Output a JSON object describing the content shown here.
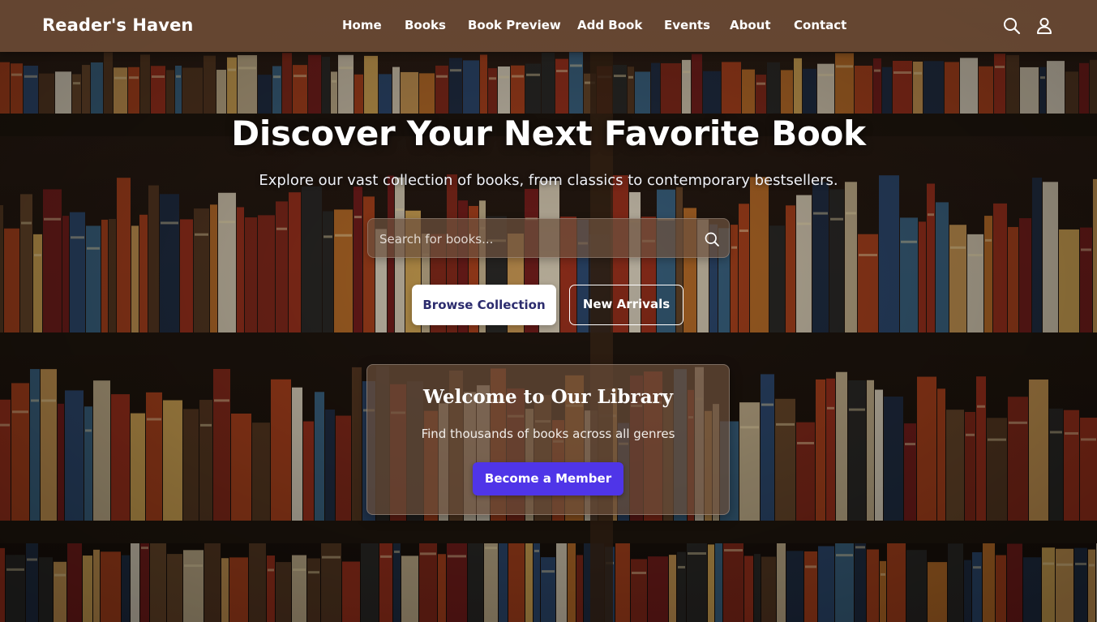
{
  "navbar": {
    "brand": "Reader's Haven",
    "links": [
      "Home",
      "Books",
      "Book Preview",
      "Add Book",
      "Events",
      "About",
      "Contact"
    ],
    "icons": [
      "search-icon",
      "user-icon"
    ]
  },
  "hero": {
    "title": "Discover Your Next Favorite Book",
    "subtitle": "Explore our vast collection of books, from classics to contemporary bestsellers.",
    "search_placeholder": "Search for books...",
    "primary_button": "Browse Collection",
    "secondary_button": "New Arrivals"
  },
  "welcome_card": {
    "title": "Welcome to Our Library",
    "subtitle": "Find thousands of books across all genres",
    "button": "Become a Member"
  },
  "colors": {
    "accent": "#4f35e8",
    "primary_button_text": "#2c2c6e",
    "navbar_bg": "#7a543c"
  }
}
